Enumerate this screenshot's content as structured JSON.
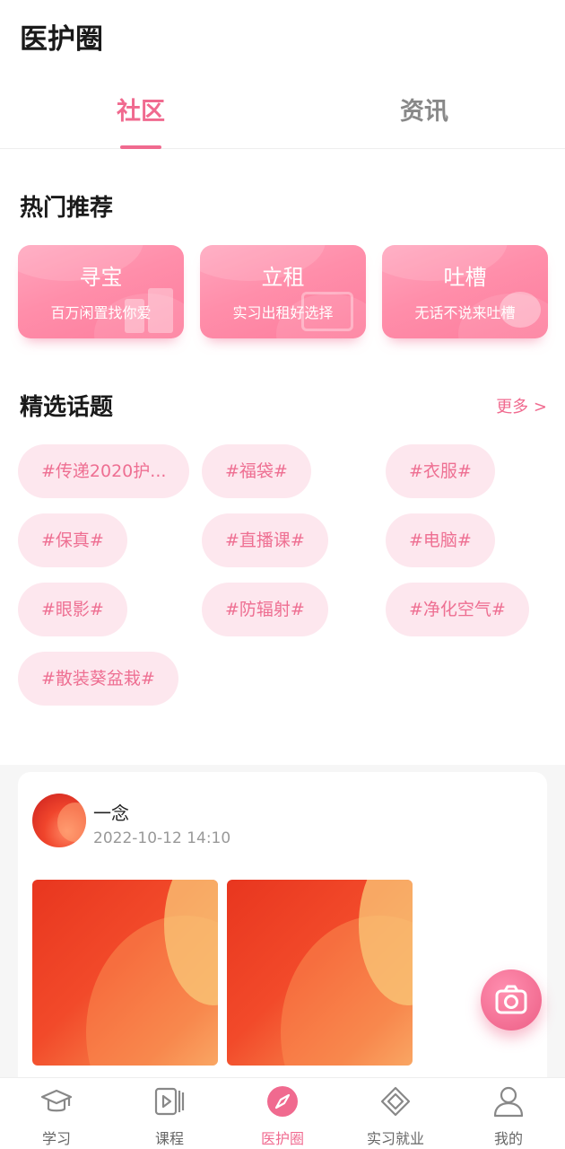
{
  "app": {
    "title": "医护圈"
  },
  "tabs": [
    {
      "label": "社区",
      "active": true
    },
    {
      "label": "资讯",
      "active": false
    }
  ],
  "hot": {
    "title": "热门推荐",
    "cards": [
      {
        "name": "寻宝",
        "subtitle": "百万闲置找你爱",
        "icon": "building-icon"
      },
      {
        "name": "立租",
        "subtitle": "实习出租好选择",
        "icon": "window-icon"
      },
      {
        "name": "吐槽",
        "subtitle": "无话不说来吐槽",
        "icon": "speech-bubble-icon"
      }
    ]
  },
  "topics": {
    "title": "精选话题",
    "more": "更多 >",
    "items": [
      "#传递2020护...",
      "#福袋#",
      "#衣服#",
      "#保真#",
      "#直播课#",
      "#电脑#",
      "#眼影#",
      "#防辐射#",
      "#净化空气#",
      "#散装葵盆栽#"
    ]
  },
  "post": {
    "author": "一念",
    "time": "2022-10-12 14:10"
  },
  "fab": {
    "icon": "camera-icon"
  },
  "tabbar": {
    "items": [
      {
        "label": "学习",
        "icon": "graduation-cap-icon",
        "active": false
      },
      {
        "label": "课程",
        "icon": "video-course-icon",
        "active": false
      },
      {
        "label": "医护圈",
        "icon": "compass-icon",
        "active": true
      },
      {
        "label": "实习就业",
        "icon": "handshake-icon",
        "active": false
      },
      {
        "label": "我的",
        "icon": "user-icon",
        "active": false
      }
    ]
  },
  "colors": {
    "accent": "#f06a8f",
    "chip_bg": "#fde7ee",
    "chip_text": "#ee6f92"
  }
}
